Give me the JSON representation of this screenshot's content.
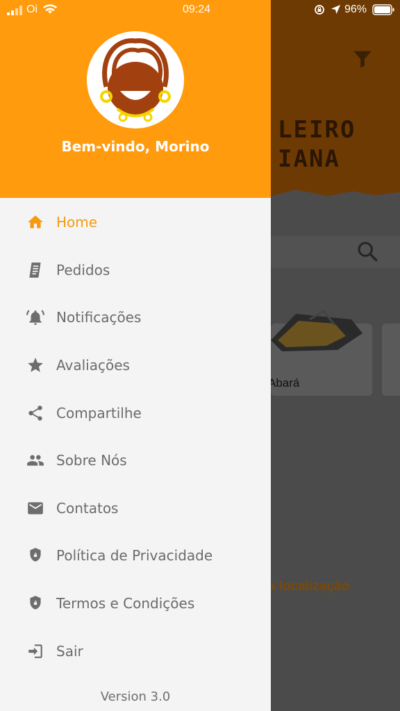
{
  "status_bar": {
    "carrier": "Oi",
    "time": "09:24",
    "battery": "96%"
  },
  "background": {
    "logo_line1": "LEIRO",
    "logo_line2": "IANA",
    "card_label": "Abará",
    "location_text": "a localização"
  },
  "drawer": {
    "welcome": "Bem-vindo, Morino",
    "version": "Version 3.0",
    "accent_color": "#ff9b0d",
    "items": [
      {
        "label": "Home",
        "icon": "home-icon"
      },
      {
        "label": "Pedidos",
        "icon": "receipt-icon"
      },
      {
        "label": "Notificações",
        "icon": "bell-icon"
      },
      {
        "label": "Avaliações",
        "icon": "star-icon"
      },
      {
        "label": "Compartilhe",
        "icon": "share-icon"
      },
      {
        "label": "Sobre Nós",
        "icon": "people-icon"
      },
      {
        "label": "Contatos",
        "icon": "mail-icon"
      },
      {
        "label": "Política de Privacidade",
        "icon": "shield-icon"
      },
      {
        "label": "Termos e Condições",
        "icon": "shield-icon"
      },
      {
        "label": "Sair",
        "icon": "logout-icon"
      }
    ]
  }
}
